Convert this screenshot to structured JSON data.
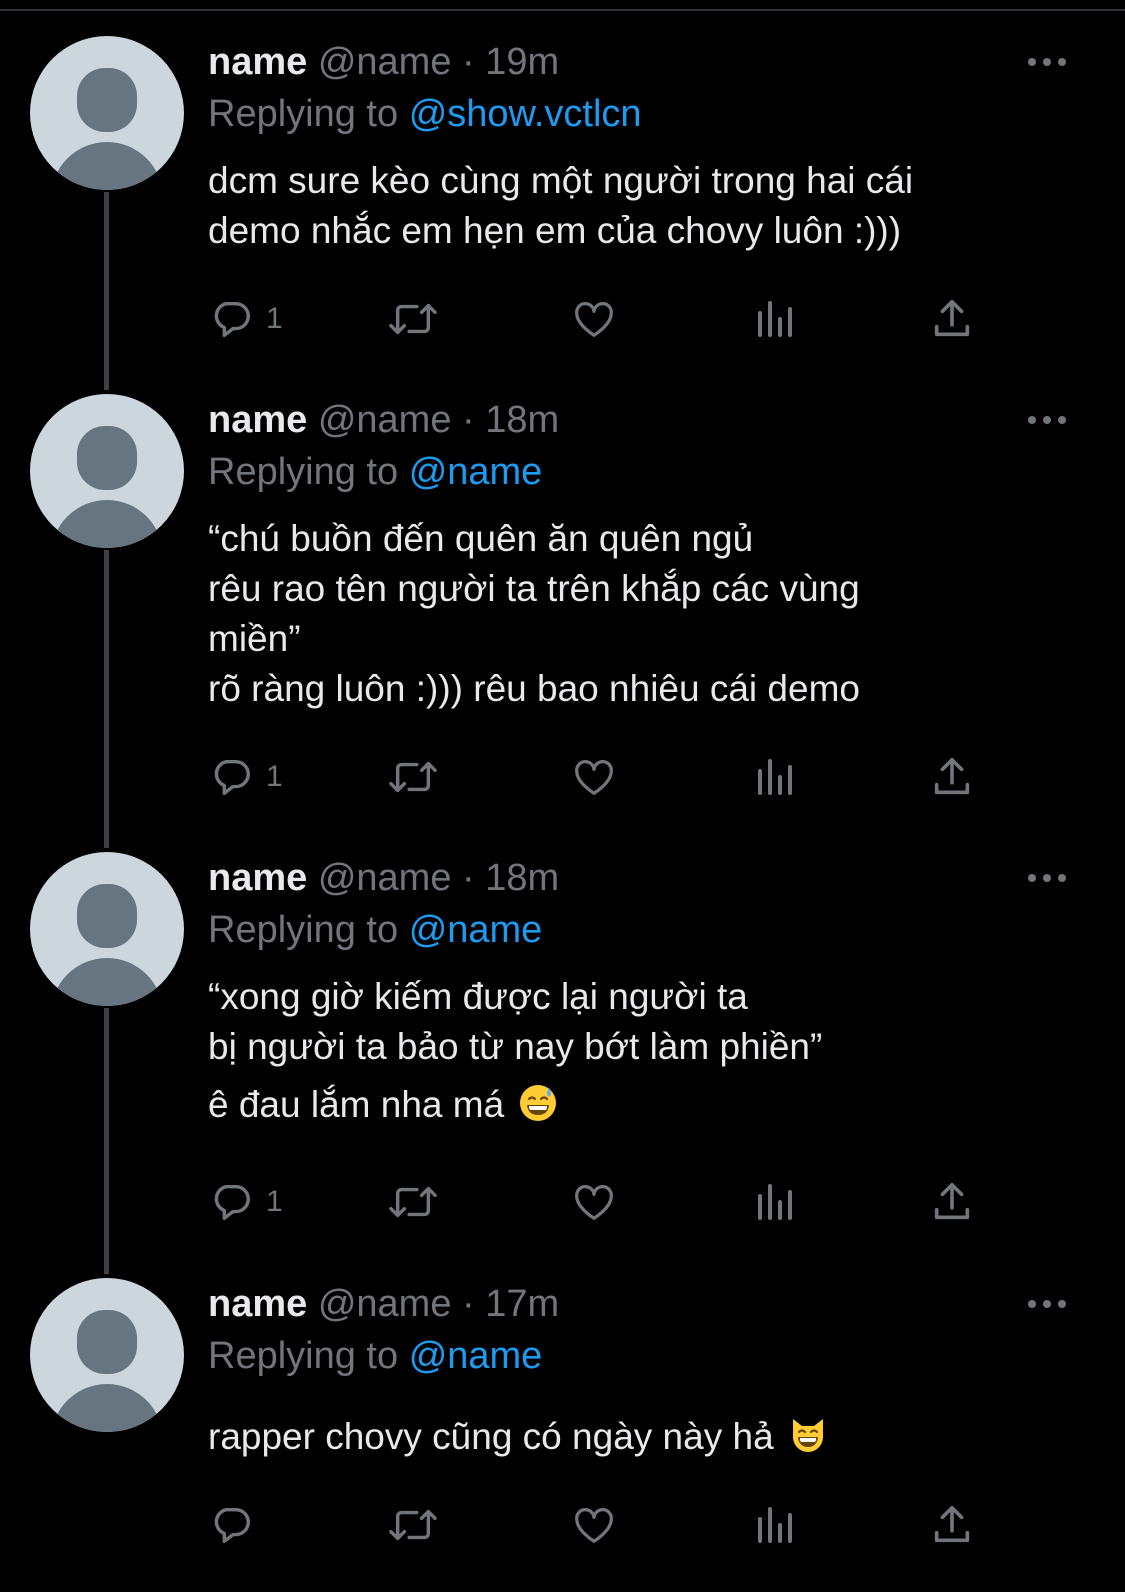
{
  "tweets": [
    {
      "name": "name",
      "handle": "@name",
      "separator": "·",
      "time": "19m",
      "replying_prefix": "Replying to",
      "replying_to": "@show.vctlcn",
      "lines": [
        "dcm sure kèo cùng một người trong hai cái",
        "demo nhắc em hẹn em của chovy luôn :)))"
      ],
      "reply_count": "1"
    },
    {
      "name": "name",
      "handle": "@name",
      "separator": "·",
      "time": "18m",
      "replying_prefix": "Replying to",
      "replying_to": "@name",
      "lines": [
        "“chú buồn đến quên ăn quên ngủ",
        "rêu rao tên người ta trên khắp các vùng",
        "miền”",
        "rõ ràng luôn :))) rêu bao nhiêu cái demo"
      ],
      "reply_count": "1"
    },
    {
      "name": "name",
      "handle": "@name",
      "separator": "·",
      "time": "18m",
      "replying_prefix": "Replying to",
      "replying_to": "@name",
      "lines": [
        "“xong giờ kiếm được lại người ta",
        "bị người ta bảo từ nay bớt làm phiền”"
      ],
      "extra_line": "ê đau lắm nha má",
      "extra_emoji": "grinning-sweat-emoji",
      "reply_count": "1"
    },
    {
      "name": "name",
      "handle": "@name",
      "separator": "·",
      "time": "17m",
      "replying_prefix": "Replying to",
      "replying_to": "@name",
      "lines": [
        "rapper chovy cũng có ngày này hả"
      ],
      "emoji": "grinning-cat-emoji",
      "reply_count": ""
    }
  ],
  "icons": {
    "reply": "reply-icon",
    "retweet": "retweet-icon",
    "like": "heart-icon",
    "views": "analytics-icon",
    "share": "share-icon",
    "more": "more-icon"
  },
  "colors": {
    "background": "#000000",
    "text": "#e7e9ea",
    "muted": "#71767b",
    "link": "#1d9bf0",
    "thread_line": "#3e4144",
    "avatar_bg": "#ccd6dd",
    "avatar_fg": "#66757f"
  }
}
